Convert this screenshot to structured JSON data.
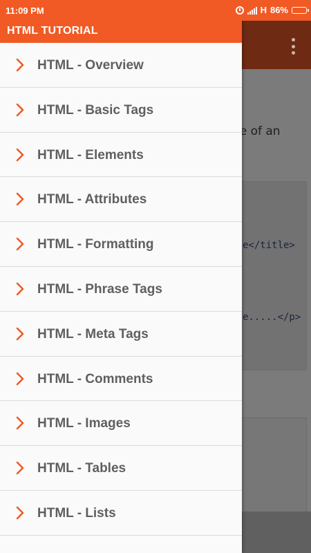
{
  "status_bar": {
    "time": "11:09 PM",
    "network": "H",
    "battery": "86%",
    "battery_level": 0.86,
    "icons": [
      "alarm-icon",
      "signal-icon",
      "battery-icon"
    ]
  },
  "drawer": {
    "title": "HTML TUTORIAL",
    "accent_color": "#f15a24",
    "item_icon": "chevron-right-icon",
    "items": [
      {
        "label": "HTML - Overview"
      },
      {
        "label": "HTML - Basic Tags"
      },
      {
        "label": "HTML - Elements"
      },
      {
        "label": "HTML - Attributes"
      },
      {
        "label": "HTML - Formatting"
      },
      {
        "label": "HTML - Phrase Tags"
      },
      {
        "label": "HTML - Meta Tags"
      },
      {
        "label": "HTML - Comments"
      },
      {
        "label": "HTML - Images"
      },
      {
        "label": "HTML - Tables"
      },
      {
        "label": "HTML - Lists"
      }
    ]
  },
  "background": {
    "toolbar_icon": "overflow-menu-icon",
    "text_fragment": "le of an",
    "code_lines": [
      "e</title>",
      "e.....</p>"
    ]
  }
}
